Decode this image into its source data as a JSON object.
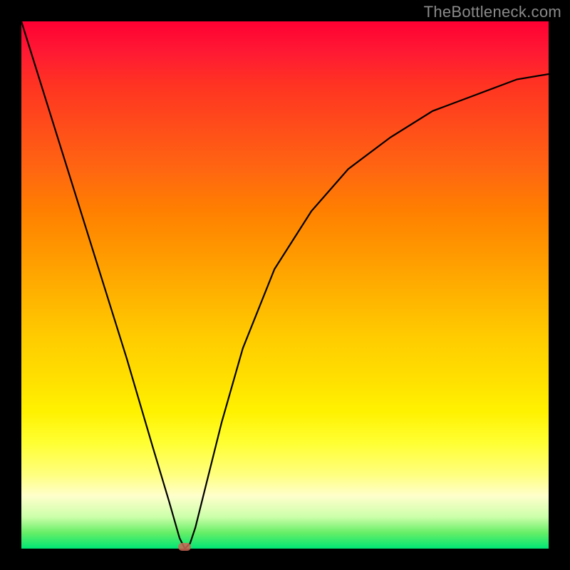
{
  "watermark": "TheBottleneck.com",
  "chart_data": {
    "type": "line",
    "title": "",
    "xlabel": "",
    "ylabel": "",
    "xlim": [
      0,
      100
    ],
    "ylim": [
      0,
      100
    ],
    "grid": false,
    "legend": false,
    "background_gradient": {
      "top": "#ff0033",
      "upper_mid": "#ff8000",
      "mid": "#ffcc00",
      "lower_mid": "#ffff66",
      "bottom": "#00e676"
    },
    "series": [
      {
        "name": "bottleneck-curve",
        "color": "#000000",
        "x": [
          0,
          5,
          10,
          15,
          20,
          25,
          28,
          30,
          31,
          32,
          33,
          35,
          38,
          42,
          48,
          55,
          62,
          70,
          78,
          86,
          94,
          100
        ],
        "y": [
          100,
          84,
          68,
          52,
          36,
          19,
          9,
          2,
          0,
          1,
          4,
          12,
          24,
          38,
          53,
          64,
          72,
          78,
          83,
          86,
          89,
          90
        ]
      }
    ],
    "markers": [
      {
        "name": "optimal-point",
        "x": 31,
        "y": 0,
        "color": "#cc6655",
        "shape": "pill"
      }
    ]
  }
}
